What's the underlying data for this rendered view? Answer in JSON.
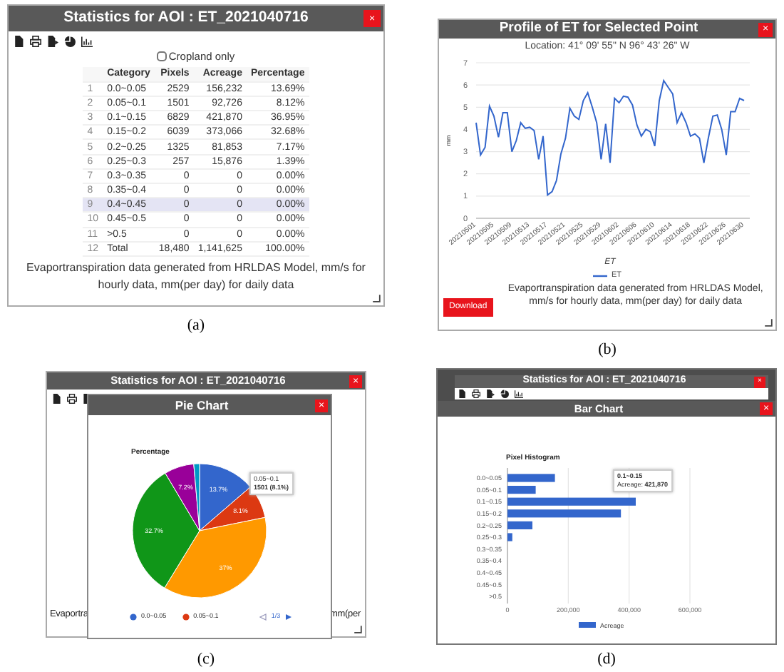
{
  "figures": [
    {
      "kind": "statistics",
      "caption": "(a)",
      "window": {
        "title": "Statistics for AOI : ET_2021040716",
        "close": "×"
      },
      "cropland_only": {
        "label": "Cropland only",
        "checked": false
      },
      "table": {
        "columns": [
          "Category",
          "Pixels",
          "Acreage",
          "Percentage"
        ],
        "rows": [
          {
            "number": "1",
            "cells": [
              "0.0~0.05",
              "2529",
              "156,232",
              "13.69%"
            ],
            "selected": false
          },
          {
            "number": "2",
            "cells": [
              "0.05~0.1",
              "1501",
              "92,726",
              "8.12%"
            ],
            "selected": false
          },
          {
            "number": "3",
            "cells": [
              "0.1~0.15",
              "6829",
              "421,870",
              "36.95%"
            ],
            "selected": false
          },
          {
            "number": "4",
            "cells": [
              "0.15~0.2",
              "6039",
              "373,066",
              "32.68%"
            ],
            "selected": false
          },
          {
            "number": "5",
            "cells": [
              "0.2~0.25",
              "1325",
              "81,853",
              "7.17%"
            ],
            "selected": false
          },
          {
            "number": "6",
            "cells": [
              "0.25~0.3",
              "257",
              "15,876",
              "1.39%"
            ],
            "selected": false
          },
          {
            "number": "7",
            "cells": [
              "0.3~0.35",
              "0",
              "0",
              "0.00%"
            ],
            "selected": false
          },
          {
            "number": "8",
            "cells": [
              "0.35~0.4",
              "0",
              "0",
              "0.00%"
            ],
            "selected": false
          },
          {
            "number": "9",
            "cells": [
              "0.4~0.45",
              "0",
              "0",
              "0.00%"
            ],
            "selected": true
          },
          {
            "number": "10",
            "cells": [
              "0.45~0.5",
              "0",
              "0",
              "0.00%"
            ],
            "selected": false
          },
          {
            "number": "11",
            "cells": [
              ">0.5",
              "0",
              "0",
              "0.00%"
            ],
            "selected": false
          },
          {
            "number": "12",
            "cells": [
              "Total",
              "18,480",
              "1,141,625",
              "100.00%"
            ],
            "selected": false
          }
        ]
      },
      "note": "Evaportranspiration data generated from HRLDAS Model, mm/s for hourly data, mm(per day) for daily data"
    },
    {
      "kind": "profile",
      "caption": "(b)",
      "window": {
        "title": "Profile of ET for Selected Point",
        "close": "×"
      },
      "location": "Location: 41° 09' 55\" N 96° 43' 26\" W",
      "chart_data": {
        "type": "line",
        "xlabel": "ET",
        "ylabel": "mm",
        "categories": [
          "20210501",
          null,
          null,
          null,
          "20210505",
          null,
          null,
          null,
          "20210509",
          null,
          null,
          null,
          "20210513",
          null,
          null,
          null,
          "20210517",
          null,
          null,
          null,
          "20210521",
          null,
          null,
          null,
          "20210525",
          null,
          null,
          null,
          "20210529",
          null,
          null,
          null,
          "20210602",
          null,
          null,
          null,
          "20210606",
          null,
          null,
          null,
          "20210610",
          null,
          null,
          null,
          "20210614",
          null,
          null,
          null,
          "20210618",
          null,
          null,
          null,
          "20210622",
          null,
          null,
          null,
          "20210626",
          null,
          null,
          null,
          "20210630"
        ],
        "series": [
          {
            "name": "ET",
            "color": "#3366cc",
            "values": [
              4.3,
              2.85,
              3.2,
              5.05,
              4.6,
              3.65,
              4.75,
              4.75,
              3.0,
              3.5,
              4.3,
              4.05,
              4.1,
              3.95,
              2.65,
              3.7,
              1.05,
              1.2,
              1.7,
              2.9,
              3.6,
              4.95,
              4.6,
              4.45,
              5.3,
              5.65,
              5.0,
              4.3,
              2.65,
              4.25,
              2.5,
              5.4,
              5.2,
              5.5,
              5.45,
              5.1,
              4.2,
              3.7,
              4.0,
              3.9,
              3.25,
              5.3,
              6.2,
              5.9,
              5.6,
              4.3,
              4.75,
              4.3,
              3.7,
              3.8,
              3.6,
              2.5,
              3.6,
              4.6,
              4.65,
              4.0,
              2.85,
              4.8,
              4.8,
              5.4,
              5.3
            ]
          }
        ],
        "ylim": [
          0,
          7
        ],
        "yticks": [
          0,
          1,
          2,
          3,
          4,
          5,
          6,
          7
        ],
        "grid": true
      },
      "note": "Evaportranspiration data generated from HRLDAS Model, mm/s for hourly data, mm(per day) for daily data",
      "download": "Download"
    },
    {
      "kind": "pie_dialog",
      "caption": "(c)",
      "background_window": {
        "title": "Statistics for AOI : ET_2021040716",
        "close": "×",
        "note_start": "Evaportra",
        "note_end": "mm(per"
      },
      "window": {
        "title": "Pie Chart",
        "close": "×"
      },
      "chart_data": {
        "type": "pie",
        "title": "Percentage",
        "categories": [
          "0.0~0.05",
          "0.05~0.1",
          null,
          null,
          null,
          null
        ],
        "values": [
          13.69,
          8.12,
          36.95,
          32.68,
          7.17,
          1.39
        ],
        "value_labels": [
          "13.7%",
          "8.1%",
          "37%",
          "32.7%",
          "7.2%",
          null
        ]
      },
      "slices": [
        {
          "color": "#3366cc"
        },
        {
          "color": "#dc3912"
        },
        {
          "color": "#ff9900"
        },
        {
          "color": "#109618"
        },
        {
          "color": "#990099"
        },
        {
          "color": "#0099c6"
        }
      ],
      "tooltip": {
        "title": "0.05~0.1",
        "value": "1501 (8.1%)"
      },
      "legend_page": "1/3"
    },
    {
      "kind": "bar_dialog",
      "caption": "(d)",
      "background_window": {
        "title": "Statistics for AOI : ET_2021040716",
        "close": "×"
      },
      "window": {
        "title": "Bar Chart",
        "close": "×"
      },
      "chart_data": {
        "type": "bar",
        "orientation": "horizontal",
        "title": "Pixel Histogram",
        "categories": [
          "0.0~0.05",
          "0.05~0.1",
          "0.1~0.15",
          "0.15~0.2",
          "0.2~0.25",
          "0.25~0.3",
          "0.3~0.35",
          "0.35~0.4",
          "0.4~0.45",
          "0.45~0.5",
          ">0.5"
        ],
        "series": [
          {
            "name": "Acreage",
            "color": "#3366cc",
            "values": [
              156232,
              92726,
              421870,
              373066,
              81853,
              15876,
              0,
              0,
              0,
              0,
              0
            ]
          }
        ],
        "xlim": [
          0,
          600000
        ],
        "xticks": [
          {
            "value": 0,
            "label": "0"
          },
          {
            "value": 200000,
            "label": "200,000"
          },
          {
            "value": 400000,
            "label": "400,000"
          },
          {
            "value": 600000,
            "label": "600,000"
          }
        ]
      },
      "tooltip": {
        "title": "0.1~0.15",
        "label": "Acreage:",
        "value": "421,870"
      }
    }
  ]
}
